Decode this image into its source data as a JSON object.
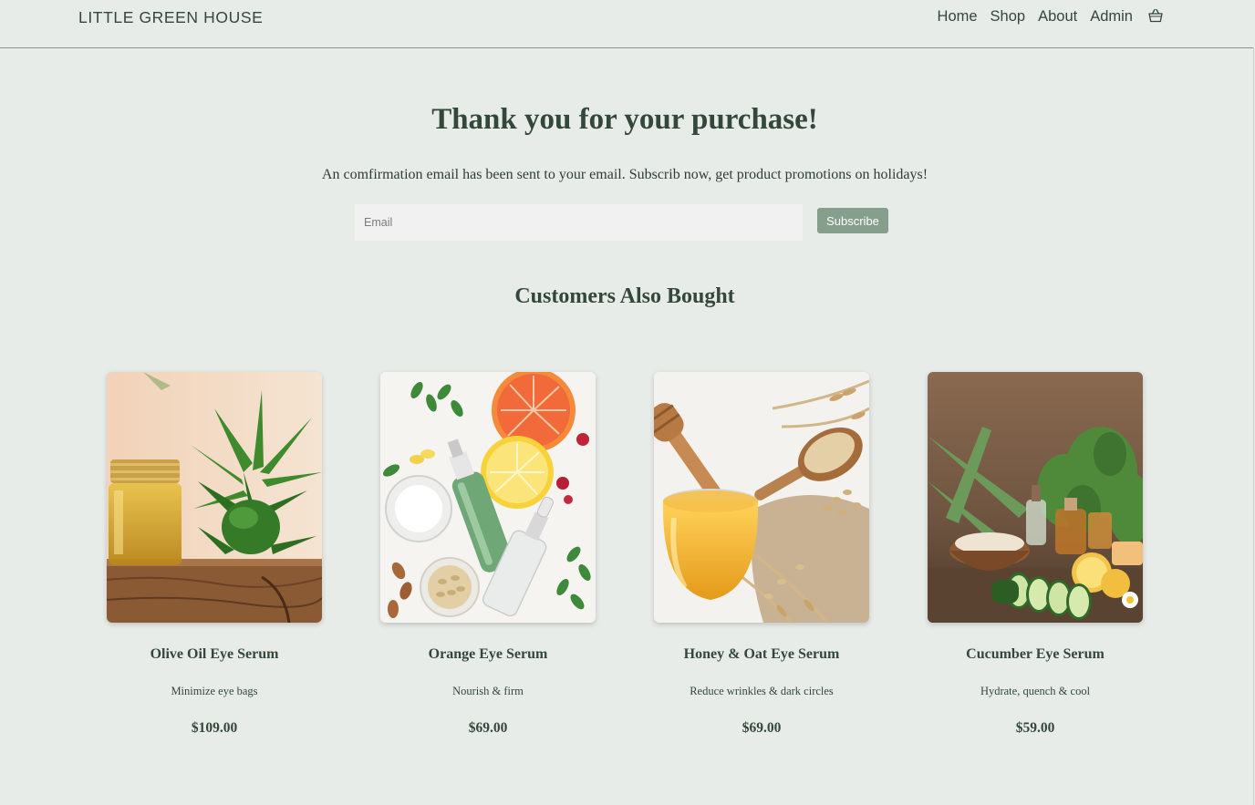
{
  "header": {
    "brand": "LITTLE GREEN HOUSE",
    "nav": [
      {
        "label": "Home"
      },
      {
        "label": "Shop"
      },
      {
        "label": "About"
      },
      {
        "label": "Admin"
      }
    ],
    "cart_icon": "basket-icon"
  },
  "confirmation": {
    "title": "Thank you for your purchase!",
    "message": "An comfirmation email has been sent to your email. Subscrib now, get product promotions on holidays!",
    "email_placeholder": "Email",
    "email_value": "",
    "subscribe_label": "Subscribe"
  },
  "recommendations": {
    "title": "Customers Also Bought",
    "products": [
      {
        "name": "Olive Oil Eye Serum",
        "description": "Minimize eye bags",
        "price": "$109.00",
        "image": "olive-oil-jar-with-herbs"
      },
      {
        "name": "Orange Eye Serum",
        "description": "Nourish & firm",
        "price": "$69.00",
        "image": "citrus-and-serum-bottles"
      },
      {
        "name": "Honey & Oat Eye Serum",
        "description": "Reduce wrinkles & dark circles",
        "price": "$69.00",
        "image": "honey-jar-and-oats"
      },
      {
        "name": "Cucumber Eye Serum",
        "description": "Hydrate, quench & cool",
        "price": "$59.00",
        "image": "cucumber-lemon-and-aloe"
      }
    ]
  },
  "colors": {
    "background": "#e8ece8",
    "text": "#33473a",
    "accent_button": "#869f8c",
    "input_background": "#f1f1f1"
  }
}
